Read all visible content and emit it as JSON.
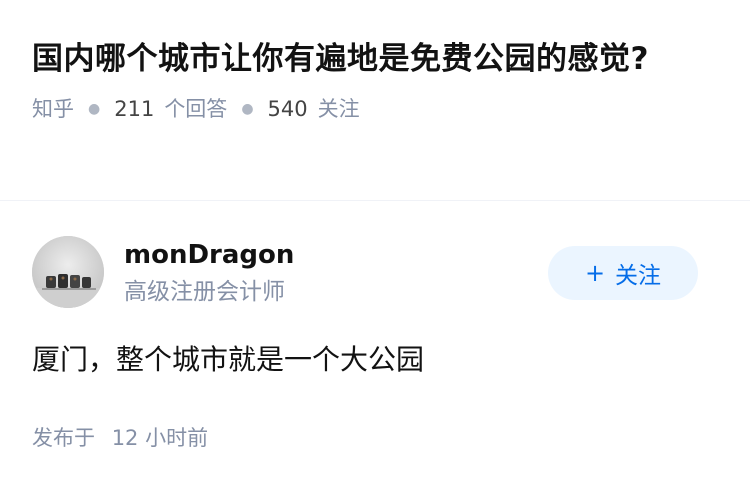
{
  "question": {
    "title": "国内哪个城市让你有遍地是免费公园的感觉?",
    "source": "知乎",
    "answer_count": "211",
    "answer_unit": "个回答",
    "follower_count": "540",
    "follower_unit": "关注"
  },
  "author": {
    "name": "monDragon",
    "headline": "高级注册会计师",
    "follow_label": "关注",
    "follow_icon": "plus-icon"
  },
  "answer": {
    "text": "厦门，整个城市就是一个大公园",
    "time_prefix": "发布于",
    "time_value": "12 小时前"
  },
  "colors": {
    "accent": "#056de8",
    "follow_bg": "#ebf5ff",
    "meta_text": "#8590a6",
    "title_text": "#121212"
  }
}
